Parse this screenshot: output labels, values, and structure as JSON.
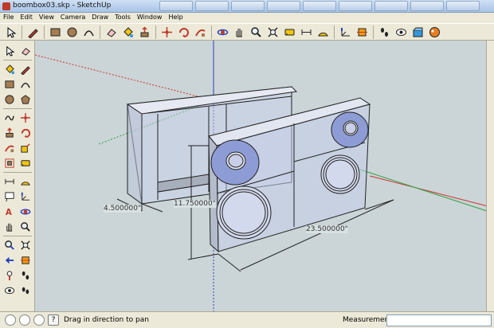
{
  "window": {
    "title": "boombox03.skp - SketchUp",
    "taskbar_tabs": [
      "",
      "",
      "",
      "",
      "",
      "",
      "",
      "",
      ""
    ]
  },
  "menu": [
    "File",
    "Edit",
    "View",
    "Camera",
    "Draw",
    "Tools",
    "Window",
    "Help"
  ],
  "toolbar": {
    "tools": [
      "select-icon",
      "pencil-icon",
      "rectangle-icon",
      "circle-icon",
      "arc-icon",
      "eraser-icon",
      "paint-bucket-icon",
      "push-pull-icon",
      "move-icon",
      "rotate-icon",
      "follow-me-icon",
      "orbit-icon",
      "pan-icon",
      "zoom-icon",
      "zoom-extents-icon",
      "tape-measure-icon",
      "dimension-icon",
      "protractor-icon",
      "axes-icon",
      "section-plane-icon",
      "walk-icon",
      "look-around-icon",
      "components-icon",
      "materials-icon"
    ]
  },
  "palette": {
    "tools": [
      "select-icon",
      "eraser-icon",
      "paint-bucket-icon",
      "line-icon",
      "rectangle-icon",
      "arc-icon",
      "circle-icon",
      "polygon-icon",
      "freehand-icon",
      "move-icon",
      "push-pull-icon",
      "rotate-icon",
      "follow-me-icon",
      "scale-icon",
      "offset-icon",
      "tape-measure-icon",
      "dimension-icon",
      "protractor-icon",
      "text-icon",
      "axes-icon",
      "3d-text-icon",
      "orbit-icon",
      "pan-icon",
      "zoom-icon",
      "zoom-window-icon",
      "zoom-extents-icon",
      "previous-view-icon",
      "section-plane-icon",
      "position-camera-icon",
      "walk-icon",
      "look-around-icon",
      "footprint-icon"
    ]
  },
  "viewport": {
    "dimensions": {
      "depth": "4.500000\"",
      "height": "11.750000\"",
      "width": "23.500000\""
    }
  },
  "status": {
    "message": "Drag in direction to pan",
    "measurements_label": "Measurements",
    "measurements_value": ""
  },
  "colors": {
    "viewport_bg": "#cbd5d7",
    "axis_red": "#d03030",
    "axis_green": "#2ea043",
    "axis_blue": "#2040c0",
    "face_tint": "#b8c4e8"
  }
}
